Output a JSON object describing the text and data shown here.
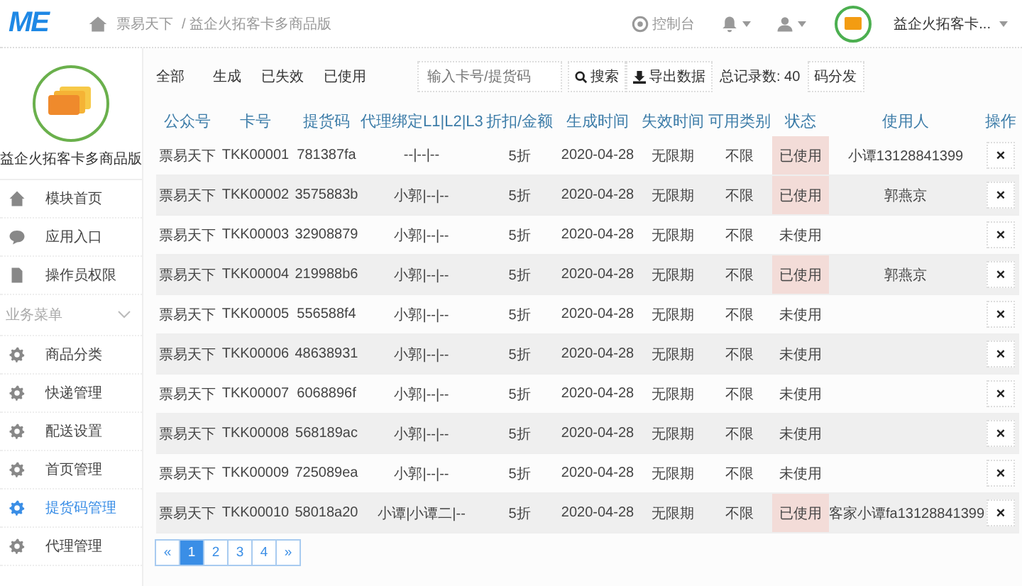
{
  "header": {
    "logo": "ME",
    "breadcrumb": [
      "票易天下",
      "/ 益企火拓客卡多商品版"
    ],
    "console": "控制台",
    "account": "益企火拓客卡..."
  },
  "sidebar": {
    "name": "益企火拓客卡多商品版",
    "items": [
      {
        "label": "模块首页",
        "selected": false
      },
      {
        "label": "应用入口",
        "selected": false
      },
      {
        "label": "操作员权限",
        "selected": false
      }
    ],
    "section": "业务菜单",
    "section_items": [
      {
        "label": "商品分类",
        "selected": false
      },
      {
        "label": "快递管理",
        "selected": false
      },
      {
        "label": "配送设置",
        "selected": false
      },
      {
        "label": "首页管理",
        "selected": false
      },
      {
        "label": "提货码管理",
        "selected": true
      },
      {
        "label": "代理管理",
        "selected": false
      }
    ]
  },
  "filters": [
    {
      "label": "全部",
      "selected": false
    },
    {
      "label": "生成",
      "selected": false
    },
    {
      "label": "已失效",
      "selected": false
    },
    {
      "label": "已使用",
      "selected": false
    }
  ],
  "search": {
    "placeholder": "输入卡号/提货码",
    "button": "搜索",
    "export": "导出数据",
    "total": "总记录数: 40",
    "distribute": "码分发"
  },
  "table": {
    "columns": [
      "公众号",
      "卡号",
      "提货码",
      "代理绑定L1|L2|L3",
      "折扣/金额",
      "生成时间",
      "失效时间",
      "可用类别",
      "状态",
      "使用人",
      "操作"
    ],
    "rows": [
      {
        "cells": [
          "票易天下",
          "TKK00001",
          "781387fa",
          "--|--|--",
          "5折",
          "2020-04-28",
          "无限期",
          "不限",
          "已使用",
          "小谭13128841399"
        ],
        "highlighted": true
      },
      {
        "cells": [
          "票易天下",
          "TKK00002",
          "3575883b",
          "小郭|--|--",
          "5折",
          "2020-04-28",
          "无限期",
          "不限",
          "已使用",
          "郭燕京"
        ],
        "highlighted": true
      },
      {
        "cells": [
          "票易天下",
          "TKK00003",
          "32908879",
          "小郭|--|--",
          "5折",
          "2020-04-28",
          "无限期",
          "不限",
          "未使用",
          ""
        ],
        "highlighted": false
      },
      {
        "cells": [
          "票易天下",
          "TKK00004",
          "219988b6",
          "小郭|--|--",
          "5折",
          "2020-04-28",
          "无限期",
          "不限",
          "已使用",
          "郭燕京"
        ],
        "highlighted": true
      },
      {
        "cells": [
          "票易天下",
          "TKK00005",
          "556588f4",
          "小郭|--|--",
          "5折",
          "2020-04-28",
          "无限期",
          "不限",
          "未使用",
          ""
        ],
        "highlighted": false
      },
      {
        "cells": [
          "票易天下",
          "TKK00006",
          "48638931",
          "小郭|--|--",
          "5折",
          "2020-04-28",
          "无限期",
          "不限",
          "未使用",
          ""
        ],
        "highlighted": false
      },
      {
        "cells": [
          "票易天下",
          "TKK00007",
          "6068896f",
          "小郭|--|--",
          "5折",
          "2020-04-28",
          "无限期",
          "不限",
          "未使用",
          ""
        ],
        "highlighted": false
      },
      {
        "cells": [
          "票易天下",
          "TKK00008",
          "568189ac",
          "小郭|--|--",
          "5折",
          "2020-04-28",
          "无限期",
          "不限",
          "未使用",
          ""
        ],
        "highlighted": false
      },
      {
        "cells": [
          "票易天下",
          "TKK00009",
          "725089ea",
          "小郭|--|--",
          "5折",
          "2020-04-28",
          "无限期",
          "不限",
          "未使用",
          ""
        ],
        "highlighted": false
      },
      {
        "cells": [
          "票易天下",
          "TKK00010",
          "58018a20",
          "小谭|小谭二|--",
          "5折",
          "2020-04-28",
          "无限期",
          "不限",
          "已使用",
          "客家小谭fa13128841399"
        ],
        "highlighted": true
      }
    ],
    "delete": "×"
  },
  "pagination": [
    {
      "label": "«",
      "selected": false
    },
    {
      "label": "1",
      "selected": true
    },
    {
      "label": "2",
      "selected": false
    },
    {
      "label": "3",
      "selected": false
    },
    {
      "label": "4",
      "selected": false
    },
    {
      "label": "»",
      "selected": false
    }
  ]
}
